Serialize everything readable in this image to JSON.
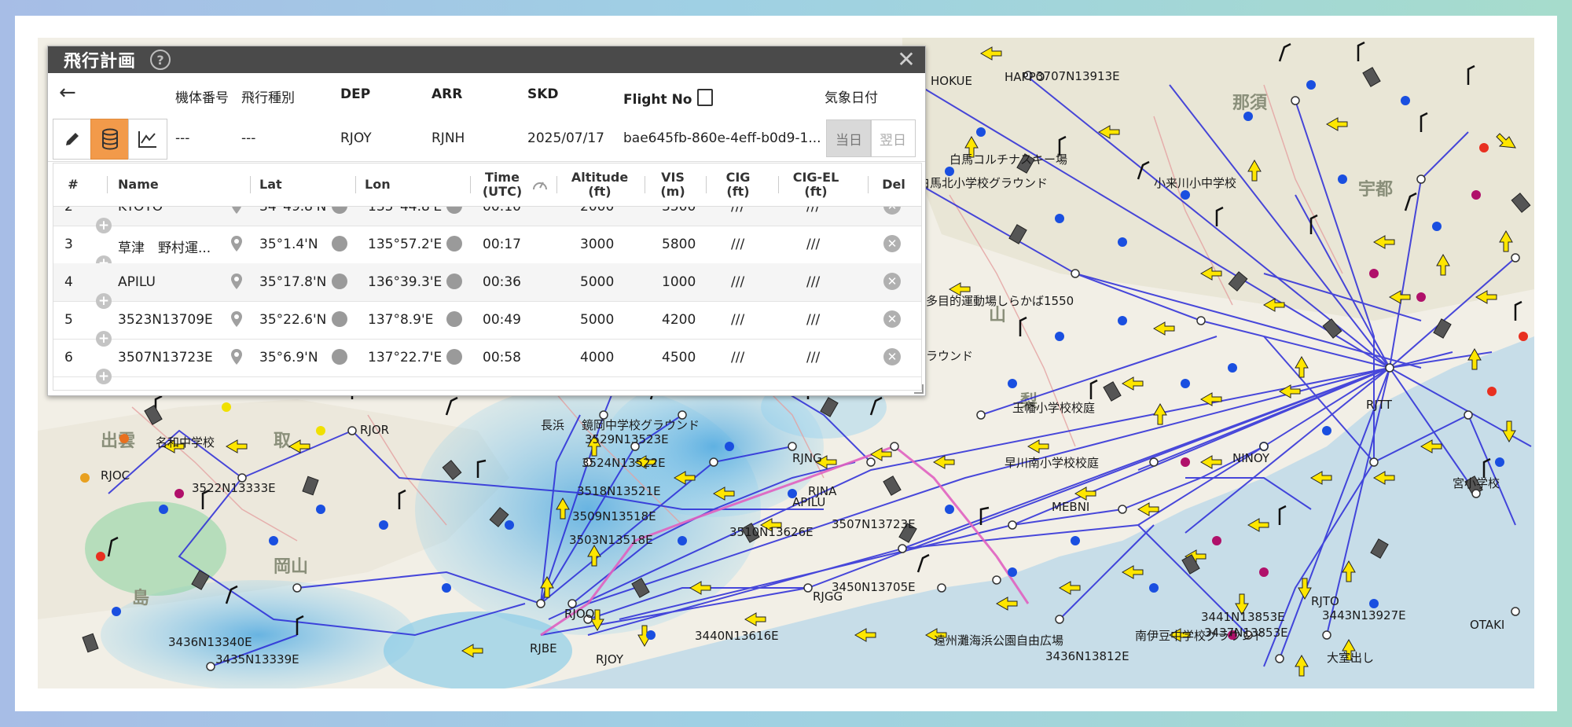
{
  "panel": {
    "title": "飛行計画",
    "help_glyph": "?",
    "close_glyph": "✕"
  },
  "header": {
    "back_glyph": "←",
    "labels": [
      "機体番号",
      "飛行種別",
      "DEP",
      "ARR",
      "SKD",
      "Flight No",
      "気象日付"
    ]
  },
  "plan": {
    "aircraft": "---",
    "flight_type": "---",
    "dep": "RJOY",
    "arr": "RJNH",
    "skd": "2025/07/17",
    "flight_no": "bae645fb-860e-4eff-b0d9-1...",
    "today_label": "当日",
    "tomorrow_label": "翌日"
  },
  "table": {
    "headers": {
      "num": "#",
      "name": "Name",
      "lat": "Lat",
      "lon": "Lon",
      "time_line1": "Time",
      "time_line2": "(UTC)",
      "alt_line1": "Altitude",
      "alt_line2": "(ft)",
      "vis_line1": "VIS",
      "vis_line2": "(m)",
      "cig_line1": "CIG",
      "cig_line2": "(ft)",
      "cigel_line1": "CIG-EL",
      "cigel_line2": "(ft)",
      "del": "Del"
    },
    "rows": [
      {
        "num": "2",
        "name": "KYOTO",
        "lat": "34°49.8'N",
        "lon": "135°44.8'E",
        "time": "00:10",
        "alt": "2000",
        "vis": "3500",
        "cig": "///",
        "cigel": "///"
      },
      {
        "num": "3",
        "name": "草津　野村運...",
        "lat": "35°1.4'N",
        "lon": "135°57.2'E",
        "time": "00:17",
        "alt": "3000",
        "vis": "5800",
        "cig": "///",
        "cigel": "///"
      },
      {
        "num": "4",
        "name": "APILU",
        "lat": "35°17.8'N",
        "lon": "136°39.3'E",
        "time": "00:36",
        "alt": "5000",
        "vis": "1000",
        "cig": "///",
        "cigel": "///"
      },
      {
        "num": "5",
        "name": "3523N13709E",
        "lat": "35°22.6'N",
        "lon": "137°8.9'E",
        "time": "00:49",
        "alt": "5000",
        "vis": "4200",
        "cig": "///",
        "cigel": "///"
      },
      {
        "num": "6",
        "name": "3507N13723E",
        "lat": "35°6.9'N",
        "lon": "137°22.7'E",
        "time": "00:58",
        "alt": "4000",
        "vis": "4500",
        "cig": "///",
        "cigel": "///"
      }
    ]
  },
  "map_labels": [
    "HAPPO",
    "HOKUE",
    "3707N13913E",
    "白馬コルチナスキー場",
    "白馬北小学校グラウンド",
    "小来川小中学校",
    "伊那里グラウンド",
    "多目的運動場しらかば1550",
    "玉幡小学校校庭",
    "早川南小学校校庭",
    "NINOY",
    "MEBNI",
    "RJTT",
    "宮小学校",
    "RJOR",
    "RJOC",
    "名和中学校",
    "3522N13333E",
    "長浜",
    "鏡岡中学校グラウンド",
    "3529N13523E",
    "3524N13522E",
    "3518N13521E",
    "3509N13518E",
    "3503N13518E",
    "RJNG",
    "RJNA",
    "3510N13626E",
    "3507N13723E",
    "APILU",
    "RJGG",
    "3450N13705E",
    "RJOO",
    "RJBE",
    "RJOY",
    "3440N13616E",
    "3436N13340E",
    "3435N13339E",
    "3436N13812E",
    "RJTO",
    "3443N13927E",
    "3441N13853E",
    "3437N13853E",
    "大室出し",
    "OTAKI",
    "遠州灘海浜公園自由広場",
    "南伊豆中学校グラウンド"
  ]
}
